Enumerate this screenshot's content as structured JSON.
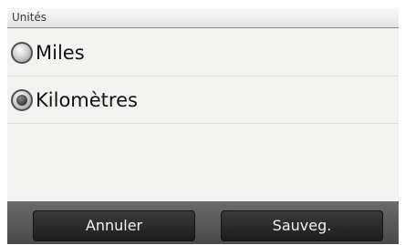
{
  "header": {
    "title": "Unités"
  },
  "options": [
    {
      "label": "Miles",
      "selected": false
    },
    {
      "label": "Kilomètres",
      "selected": true
    }
  ],
  "footer": {
    "cancel_label": "Annuler",
    "save_label": "Sauveg."
  }
}
